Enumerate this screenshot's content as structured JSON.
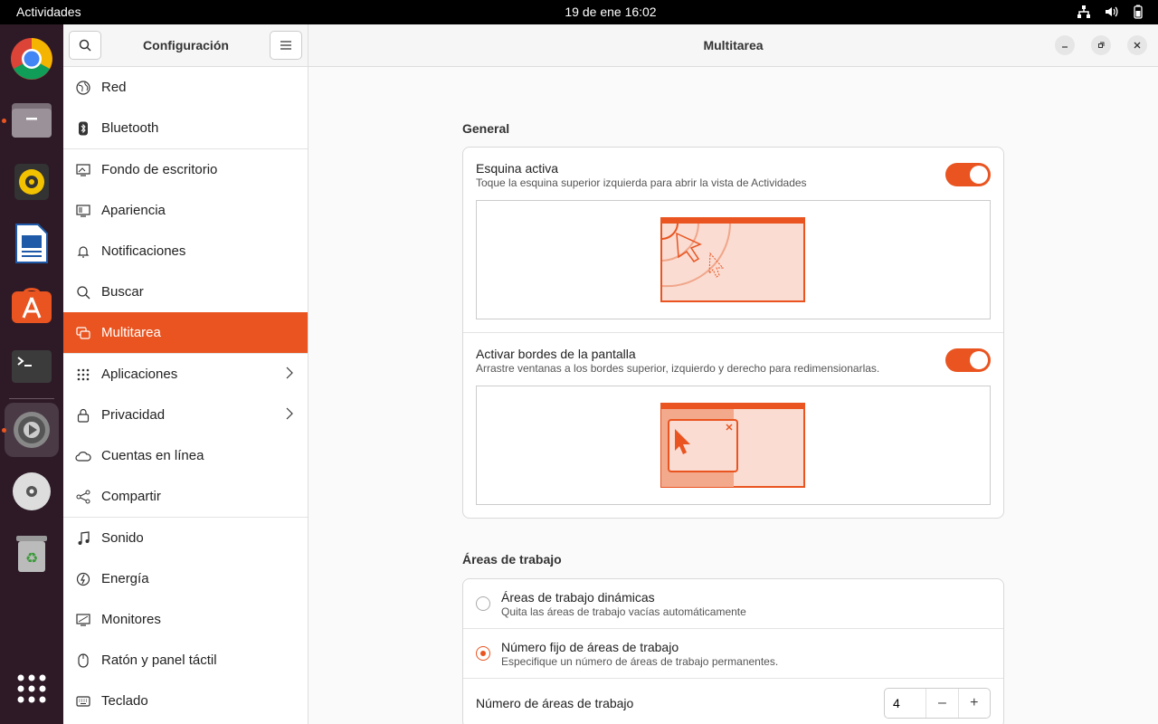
{
  "topbar": {
    "activities": "Actividades",
    "clock": "19 de ene  16:02"
  },
  "sidebar": {
    "title": "Configuración",
    "items": [
      {
        "label": "Red"
      },
      {
        "label": "Bluetooth"
      },
      {
        "label": "Fondo de escritorio"
      },
      {
        "label": "Apariencia"
      },
      {
        "label": "Notificaciones"
      },
      {
        "label": "Buscar"
      },
      {
        "label": "Multitarea"
      },
      {
        "label": "Aplicaciones"
      },
      {
        "label": "Privacidad"
      },
      {
        "label": "Cuentas en línea"
      },
      {
        "label": "Compartir"
      },
      {
        "label": "Sonido"
      },
      {
        "label": "Energía"
      },
      {
        "label": "Monitores"
      },
      {
        "label": "Ratón y panel táctil"
      },
      {
        "label": "Teclado"
      }
    ]
  },
  "main": {
    "title": "Multitarea",
    "general": {
      "title": "General",
      "hot_corner": {
        "title": "Esquina activa",
        "subtitle": "Toque la esquina superior izquierda para abrir la vista de Actividades",
        "enabled": true
      },
      "edges": {
        "title": "Activar bordes de la pantalla",
        "subtitle": "Arrastre ventanas a los bordes superior, izquierdo y derecho para redimensionarlas.",
        "enabled": true
      }
    },
    "workspaces": {
      "title": "Áreas de trabajo",
      "dynamic": {
        "title": "Áreas de trabajo dinámicas",
        "subtitle": "Quita las áreas de trabajo vacías automáticamente",
        "selected": false
      },
      "fixed": {
        "title": "Número fijo de áreas de trabajo",
        "subtitle": "Especifique un número de áreas de trabajo permanentes.",
        "selected": true
      },
      "count": {
        "label": "Número de áreas de trabajo",
        "value": "4"
      }
    }
  },
  "colors": {
    "accent": "#e95420"
  }
}
